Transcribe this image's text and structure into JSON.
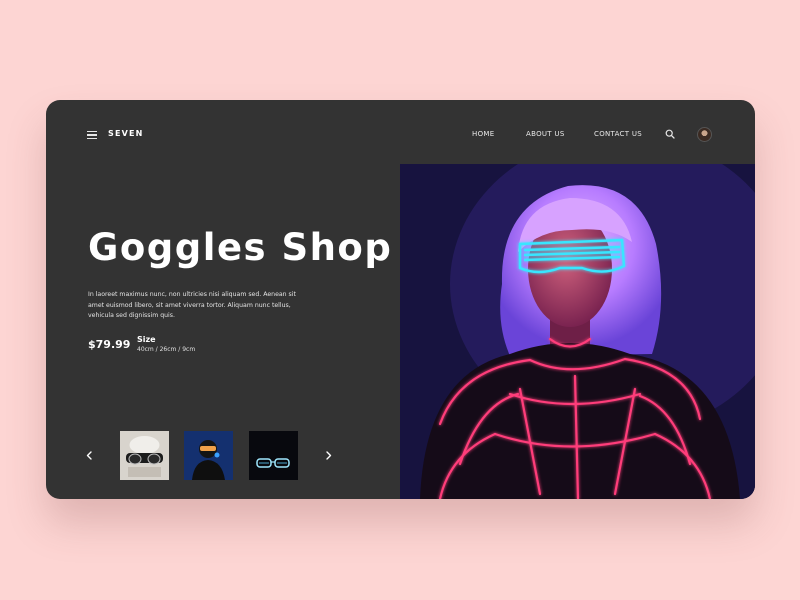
{
  "header": {
    "brand": "SEVEN",
    "nav": {
      "home": "HOME",
      "about": "ABOUT US",
      "contact": "CONTACT US"
    },
    "icons": [
      "menu-icon",
      "search-icon"
    ]
  },
  "hero": {
    "title": "Goggles Shop",
    "description": "In laoreet maximus nunc, non ultricies nisi aliquam sed. Aenean sit amet euismod libero, sit amet viverra tortor. Aliquam nunc tellus, vehicula sed dignissim quis.",
    "price": "$79.99",
    "size_label": "Size",
    "size_value": "40cm / 26cm / 9cm"
  },
  "carousel": {
    "thumbnails": [
      "white-goggles-product",
      "person-with-led-goggles",
      "neon-goggles-dark"
    ],
    "icons": [
      "chevron-left-icon",
      "chevron-right-icon"
    ]
  },
  "colors": {
    "page_background": "#fdd5d3",
    "card_background": "#333333",
    "text_primary": "#ffffff",
    "neon_cyan": "#38e6ff",
    "neon_pink": "#ff3d7a",
    "hair_purple": "#b070ff"
  }
}
